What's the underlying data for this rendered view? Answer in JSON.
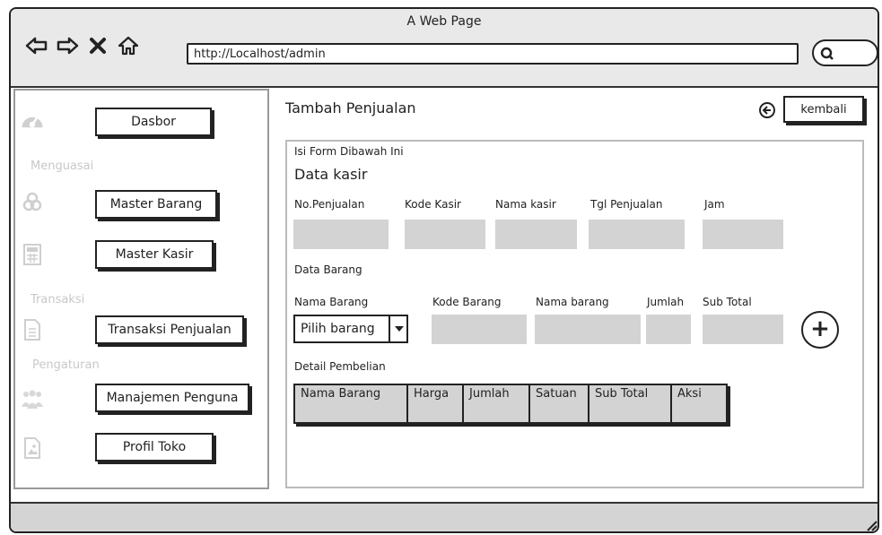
{
  "window": {
    "title": "A Web Page",
    "url": "http://Localhost/admin"
  },
  "sidebar": {
    "sections": {
      "menguasai": "Menguasai",
      "transaksi": "Transaksi",
      "pengaturan": "Pengaturan"
    },
    "items": [
      {
        "label": "Dasbor",
        "icon": "dashboard-icon"
      },
      {
        "label": "Master Barang",
        "icon": "recycle-icon"
      },
      {
        "label": "Master Kasir",
        "icon": "calculator-icon"
      },
      {
        "label": "Transaksi Penjualan",
        "icon": "document-icon"
      },
      {
        "label": "Manajemen Penguna",
        "icon": "users-icon"
      },
      {
        "label": "Profil Toko",
        "icon": "image-icon"
      }
    ]
  },
  "main": {
    "title": "Tambah Penjualan",
    "back_label": "kembali",
    "form_hint": "Isi Form Dibawah Ini",
    "kasir": {
      "heading": "Data kasir",
      "fields": [
        "No.Penjualan",
        "Kode Kasir",
        "Nama kasir",
        "Tgl Penjualan",
        "Jam"
      ]
    },
    "barang": {
      "heading": "Data Barang",
      "fields": [
        "Nama Barang",
        "Kode Barang",
        "Nama barang",
        "Jumlah",
        "Sub Total"
      ],
      "select_value": "Pilih barang"
    },
    "detail": {
      "heading": "Detail Pembelian",
      "columns": [
        "Nama Barang",
        "Harga",
        "Jumlah",
        "Satuan",
        "Sub Total",
        "Aksi"
      ]
    }
  }
}
